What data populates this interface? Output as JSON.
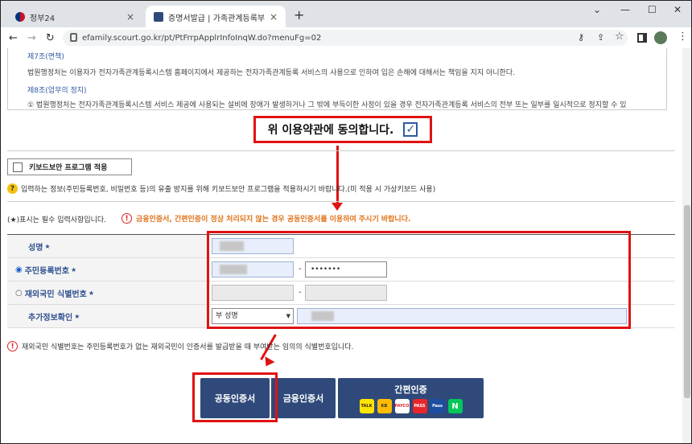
{
  "browser": {
    "tabs": [
      {
        "label": "정부24",
        "close": "×"
      },
      {
        "label": "증명서발급 | 가족관계등록부 |",
        "close": "×"
      }
    ],
    "new_tab": "+",
    "url": "efamily.scourt.go.kr/pt/PtFrrpApplrInfoInqW.do?menuFg=02",
    "window": {
      "min": "⌄",
      "minimize": "—",
      "maximize": "☐",
      "close": "✕"
    }
  },
  "terms": {
    "line1_heading": "제7조(면책)",
    "line1": "법원행정처는 이용자가 전자가족관계등록시스템 홈페이지에서 제공하는 전자가족관계등록 서비스의 사용으로 인하여 입은 손해에 대해서는 책임을 지지 아니한다.",
    "line2_heading": "제8조(업무의 정지)",
    "line2": "① 법원행정처는 전자가족관계등록시스템 서비스 제공에 사용되는 설비에 장애가 발생하거나 그 밖에 부득이한 사정이 있을 경우 전자가족관계등록 서비스의 전부 또는 일부를 일시적으로 정지할 수 있"
  },
  "agree": {
    "label": "위 이용약관에 동의합니다.",
    "checked": "✓"
  },
  "keyboard": {
    "button": "키보드보안 프로그램 적용",
    "notice": "입력하는 정보(주민등록번호, 비밀번호 등)의 유출 방지를 위해 키보드보안 프로그램을 적용하시기 바랍니다.(미 적용 시 가상키보드 사용)"
  },
  "required_note": "(★)표시는 필수 입력사항입니다.",
  "cert_warning": "금융인증서, 간편인증이 정상 처리되지 않는 경우 공동인증서를 이용하여 주시기 바랍니다.",
  "form": {
    "name_label": "성명",
    "rrn_label": "주민등록번호",
    "rrn_back": "•••••••",
    "foreign_label": "재외국민 식별번호",
    "extra_label": "추가정보확인",
    "extra_select": "부 성명",
    "dash": "-",
    "star": "★"
  },
  "foreign_note": "재외국민 식별번호는 주민등록번호가 없는 재외국민이 인증서를 발급받을 때 부여받는 임의의 식별번호입니다.",
  "buttons": {
    "joint": "공동인증서",
    "financial": "금융인증서",
    "simple": "간편인증",
    "providers": [
      "TALK",
      "KB",
      "PAYCO",
      "PASS",
      "Pass",
      "N"
    ]
  }
}
